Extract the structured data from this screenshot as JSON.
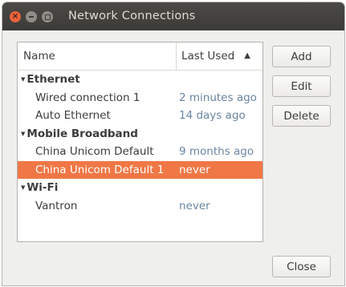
{
  "window": {
    "title": "Network Connections"
  },
  "table": {
    "columns": {
      "name": "Name",
      "last_used": "Last Used"
    },
    "sort_indicator": "▲",
    "groups": [
      {
        "label": "Ethernet",
        "items": [
          {
            "name": "Wired connection 1",
            "last_used": "2 minutes ago"
          },
          {
            "name": "Auto Ethernet",
            "last_used": "14 days ago"
          }
        ]
      },
      {
        "label": "Mobile Broadband",
        "items": [
          {
            "name": "China Unicom Default",
            "last_used": "9 months ago"
          },
          {
            "name": "China Unicom Default 1",
            "last_used": "never",
            "selected": true
          }
        ]
      },
      {
        "label": "Wi-Fi",
        "items": [
          {
            "name": "Vantron",
            "last_used": "never"
          }
        ]
      }
    ]
  },
  "buttons": {
    "add": "Add",
    "edit": "Edit",
    "delete": "Delete",
    "close": "Close"
  },
  "colors": {
    "selection": "#f07746",
    "titlebar": "#3c3b37",
    "close_button": "#e8633d"
  }
}
